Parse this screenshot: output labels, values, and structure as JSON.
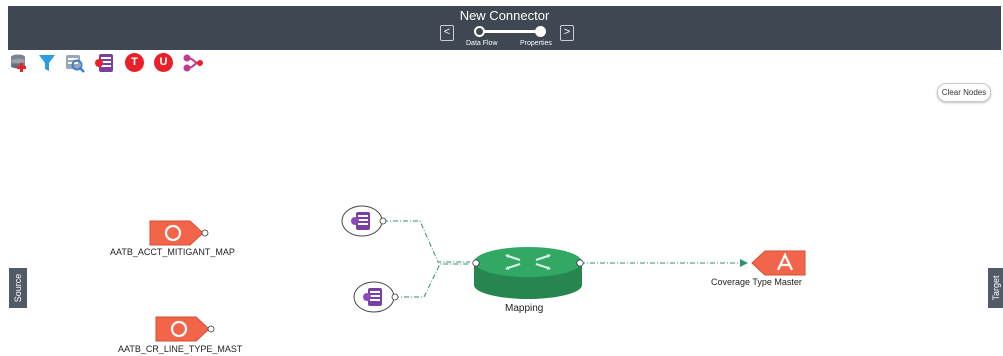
{
  "header": {
    "title": "New Connector",
    "prev_icon": "chevron-left-icon",
    "next_icon": "chevron-right-icon",
    "prev_glyph": "<",
    "next_glyph": ">",
    "steps": [
      {
        "label": "Data Flow",
        "state": "inactive"
      },
      {
        "label": "Properties",
        "state": "active"
      }
    ]
  },
  "toolbar": {
    "tools": [
      {
        "name": "add-source-icon"
      },
      {
        "name": "filter-icon"
      },
      {
        "name": "search-source-icon"
      },
      {
        "name": "expression-icon"
      },
      {
        "name": "t-badge",
        "text": "T"
      },
      {
        "name": "u-badge",
        "text": "U"
      },
      {
        "name": "join-icon"
      }
    ]
  },
  "clear_nodes_label": "Clear Nodes",
  "side_tabs": {
    "source": "Source",
    "target": "Target"
  },
  "nodes": {
    "source1": {
      "label": "AATB_ACCT_MITIGANT_MAP",
      "glyph": "O"
    },
    "source2": {
      "label": "AATB_CR_LINE_TYPE_MAST",
      "glyph": "O"
    },
    "mapping": {
      "label": "Mapping"
    },
    "target": {
      "label": "Coverage Type Master",
      "glyph": "A"
    }
  },
  "colors": {
    "header_bg": "#3f4753",
    "node_orange": "#f2654b",
    "mapping_green": "#2aa060",
    "connector_line": "#2f8f6f",
    "badge_red": "#e8202a"
  }
}
